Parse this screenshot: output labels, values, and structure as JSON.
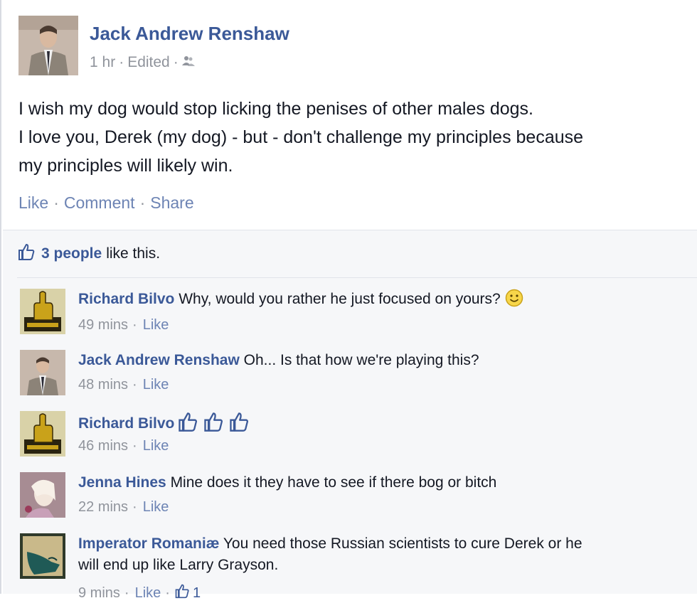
{
  "post": {
    "author": "Jack Andrew Renshaw",
    "time": "1 hr",
    "edited": "Edited",
    "audience_icon": "friends-icon",
    "body_lines": [
      "I wish my dog would stop licking the penises of other males dogs.",
      "I love you, Derek (my dog) - but - don't challenge my principles because",
      "my principles will likely win."
    ],
    "actions": {
      "like": "Like",
      "comment": "Comment",
      "share": "Share"
    }
  },
  "likes": {
    "count": "3 people",
    "rest": "like this."
  },
  "comments": [
    {
      "author": "Richard Bilvo",
      "text": "Why, would you rather he just focused on yours?",
      "emoji": "smiley-icon",
      "time": "49 mins",
      "like": "Like"
    },
    {
      "author": "Jack Andrew Renshaw",
      "text": "Oh... Is that how we're playing this?",
      "time": "48 mins",
      "like": "Like"
    },
    {
      "author": "Richard Bilvo",
      "text": "",
      "thumbs": [
        "thumbs-up-icon",
        "thumbs-up-icon",
        "thumbs-up-icon"
      ],
      "time": "46 mins",
      "like": "Like"
    },
    {
      "author": "Jenna Hines",
      "text": "Mine does it they have to see if there bog or bitch",
      "time": "22 mins",
      "like": "Like"
    },
    {
      "author": "Imperator Romaniæ",
      "text": "You need those Russian scientists to cure Derek or he",
      "text2": "will end up like Larry Grayson.",
      "time": "9 mins",
      "like": "Like",
      "like_count": "1"
    }
  ],
  "colors": {
    "link": "#3b5998",
    "muted": "#90949c",
    "action": "#6d84b4",
    "ufi_bg": "#f6f7f9"
  }
}
